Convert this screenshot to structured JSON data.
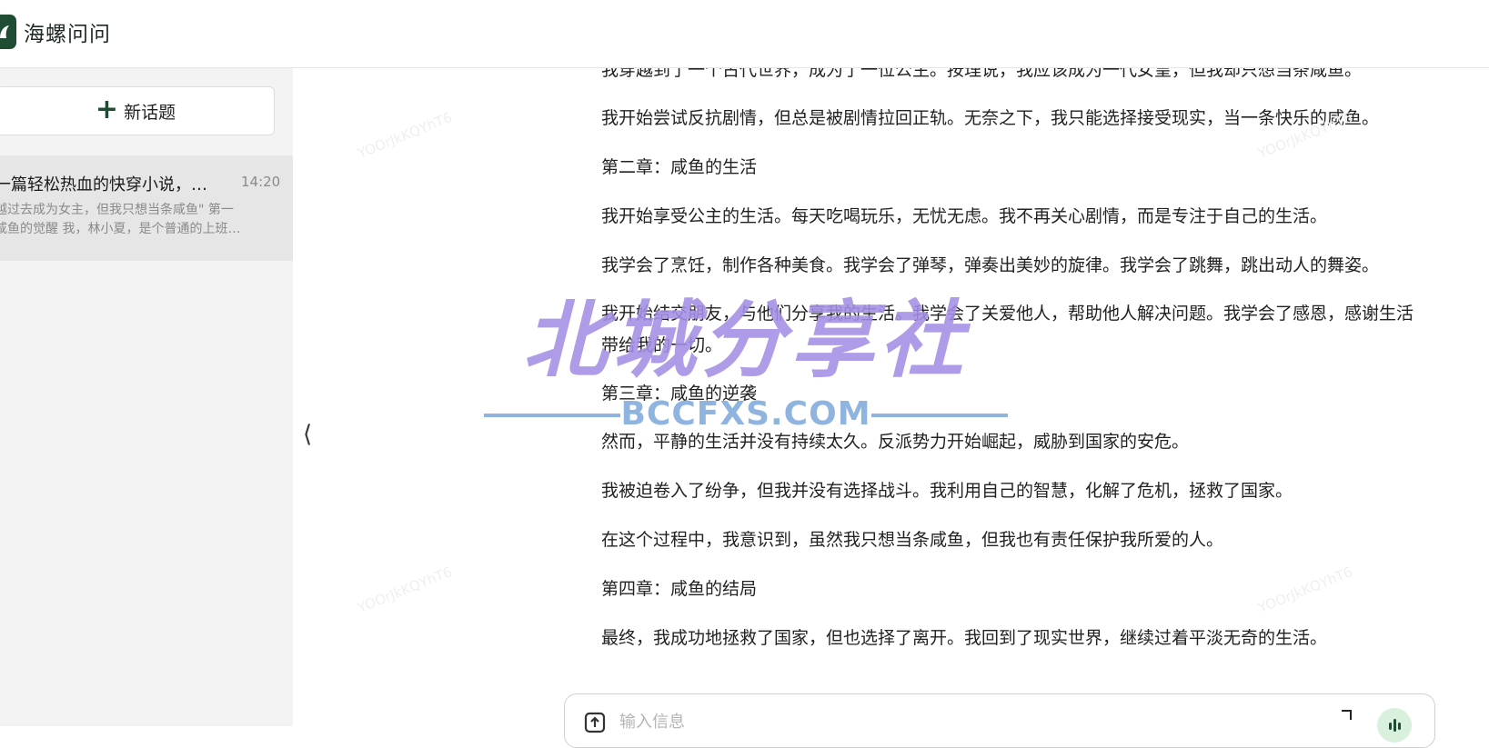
{
  "app": {
    "title": "海螺问问"
  },
  "sidebar": {
    "new_topic_label": "新话题",
    "conversations": [
      {
        "title": "一篇轻松热血的快穿小说，标…",
        "time": "14:20",
        "snippet_line1": "越过去成为女主，但我只想当条咸鱼\" 第一",
        "snippet_line2": "咸鱼的觉醒 我，林小夏，是个普通的上班…"
      }
    ]
  },
  "main": {
    "paragraphs": [
      "我穿越到了一个古代世界，成为了一位公主。按理说，我应该成为一代女皇，但我却只想当条咸鱼。",
      "我开始尝试反抗剧情，但总是被剧情拉回正轨。无奈之下，我只能选择接受现实，当一条快乐的咸鱼。",
      "第二章：咸鱼的生活",
      "我开始享受公主的生活。每天吃喝玩乐，无忧无虑。我不再关心剧情，而是专注于自己的生活。",
      "我学会了烹饪，制作各种美食。我学会了弹琴，弹奏出美妙的旋律。我学会了跳舞，跳出动人的舞姿。",
      "我开始结交朋友，与他们分享我的生活。我学会了关爱他人，帮助他人解决问题。我学会了感恩，感谢生活带给我的一切。",
      "第三章：咸鱼的逆袭",
      "然而，平静的生活并没有持续太久。反派势力开始崛起，威胁到国家的安危。",
      "我被迫卷入了纷争，但我并没有选择战斗。我利用自己的智慧，化解了危机，拯救了国家。",
      "在这个过程中，我意识到，虽然我只想当条咸鱼，但我也有责任保护我所爱的人。",
      "第四章：咸鱼的结局",
      "最终，我成功地拯救了国家，但也选择了离开。我回到了现实世界，继续过着平淡无奇的生活。"
    ]
  },
  "watermark": {
    "main_text": "北城分享社",
    "sub_text": "BCCFXS.COM",
    "faint_text": "YOOrJkKQYhT6"
  },
  "input": {
    "placeholder": "输入信息"
  },
  "icons": {
    "logo": "hailuo-logo-icon",
    "new_topic": "plus-icon",
    "collapse": "chevron-left-icon",
    "attach": "attachment-icon",
    "expand": "expand-icon",
    "voice": "voice-icon"
  },
  "colors": {
    "brand": "#1f4d33",
    "sidebar_bg": "#f3f3f3",
    "selected_bg": "#e6e6e6",
    "voice_bg": "#d8f0dc"
  }
}
